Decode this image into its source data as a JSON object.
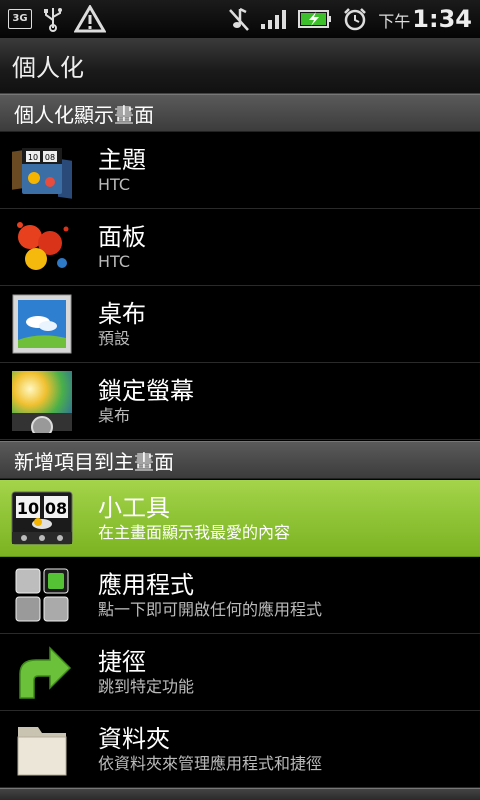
{
  "status_bar": {
    "network": "3G",
    "time_prefix": "下午",
    "time": "1:34",
    "icons": [
      "3g-icon",
      "usb-icon",
      "warning-icon",
      "mute-icon",
      "signal-icon",
      "battery-charging-icon",
      "alarm-icon"
    ]
  },
  "title": "個人化",
  "sections": [
    {
      "label": "個人化顯示畫面"
    },
    {
      "label": "新增項目到主畫面"
    }
  ],
  "display_items": [
    {
      "label": "主題",
      "sub": "HTC",
      "icon": "themes-icon"
    },
    {
      "label": "面板",
      "sub": "HTC",
      "icon": "skins-icon"
    },
    {
      "label": "桌布",
      "sub": "預設",
      "icon": "wallpaper-icon"
    },
    {
      "label": "鎖定螢幕",
      "sub": "桌布",
      "icon": "lockscreen-icon"
    }
  ],
  "add_items": [
    {
      "label": "小工具",
      "sub": "在主畫面顯示我最愛的內容",
      "icon": "widget-icon",
      "selected": true
    },
    {
      "label": "應用程式",
      "sub": "點一下即可開啟任何的應用程式",
      "icon": "apps-icon"
    },
    {
      "label": "捷徑",
      "sub": "跳到特定功能",
      "icon": "shortcut-icon"
    },
    {
      "label": "資料夾",
      "sub": "依資料夾來管理應用程式和捷徑",
      "icon": "folder-icon"
    }
  ],
  "widget_icon_clock": [
    "10",
    "08"
  ],
  "colors": {
    "accent": "#8cc43a",
    "section_bg": "#4a4a4a"
  }
}
